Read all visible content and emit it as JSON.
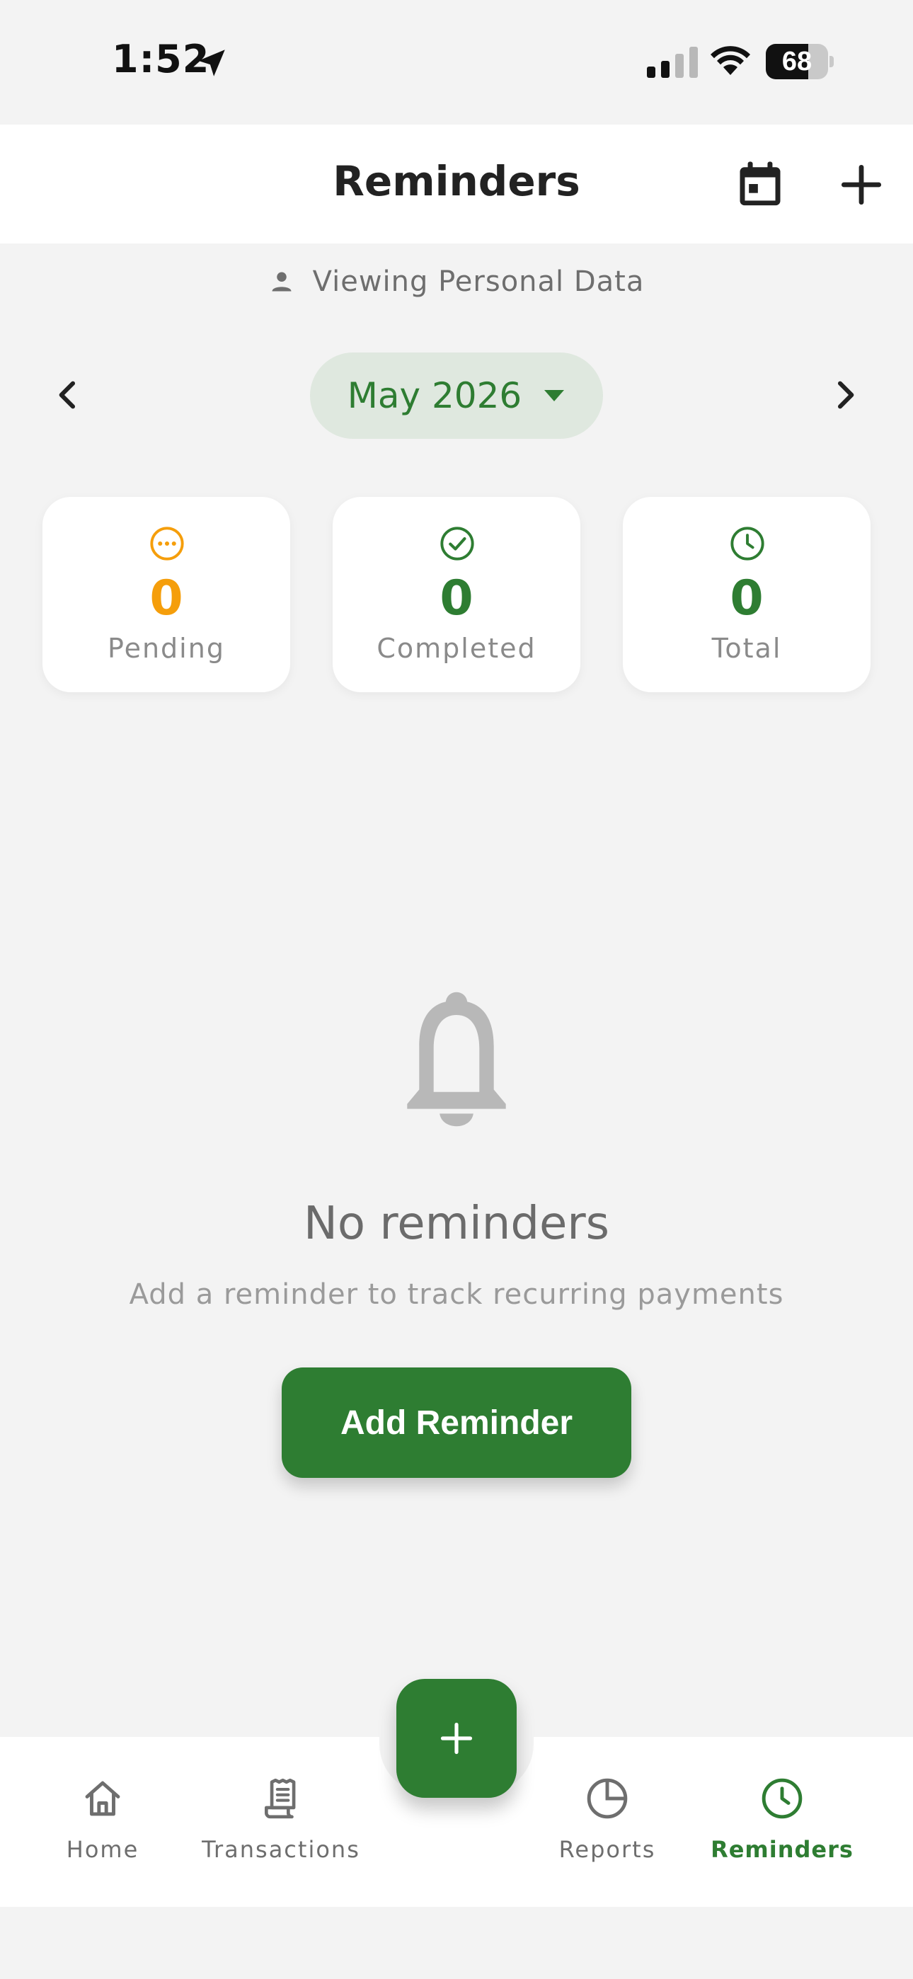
{
  "status_bar": {
    "time": "1:52",
    "battery": "68",
    "battery_level": 0.68
  },
  "header": {
    "title": "Reminders",
    "calendar_icon": "calendar-icon",
    "add_icon": "plus-icon"
  },
  "viewing": {
    "text": "Viewing Personal Data",
    "icon": "person-icon"
  },
  "month_selector": {
    "label": "May 2026",
    "prev_icon": "chevron-left-icon",
    "next_icon": "chevron-right-icon",
    "dropdown_icon": "caret-down-icon"
  },
  "stats": {
    "pending": {
      "value": "0",
      "label": "Pending",
      "color": "#f59e0b",
      "icon": "dots-circle-icon"
    },
    "completed": {
      "value": "0",
      "label": "Completed",
      "color": "#2e7d32",
      "icon": "check-circle-icon"
    },
    "total": {
      "value": "0",
      "label": "Total",
      "color": "#2e7d32",
      "icon": "clock-icon"
    }
  },
  "empty_state": {
    "icon": "bell-icon",
    "title": "No reminders",
    "subtitle": "Add a reminder to track recurring payments",
    "button": "Add Reminder"
  },
  "bottom_nav": {
    "items": [
      {
        "label": "Home",
        "icon": "home-icon"
      },
      {
        "label": "Transactions",
        "icon": "receipt-icon"
      },
      {
        "label": "Reports",
        "icon": "pie-chart-icon"
      },
      {
        "label": "Reminders",
        "icon": "clock-icon",
        "active": true
      }
    ],
    "fab_icon": "plus-icon"
  },
  "colors": {
    "accent": "#2e7d32",
    "pending": "#f59e0b",
    "background": "#f3f3f3"
  }
}
